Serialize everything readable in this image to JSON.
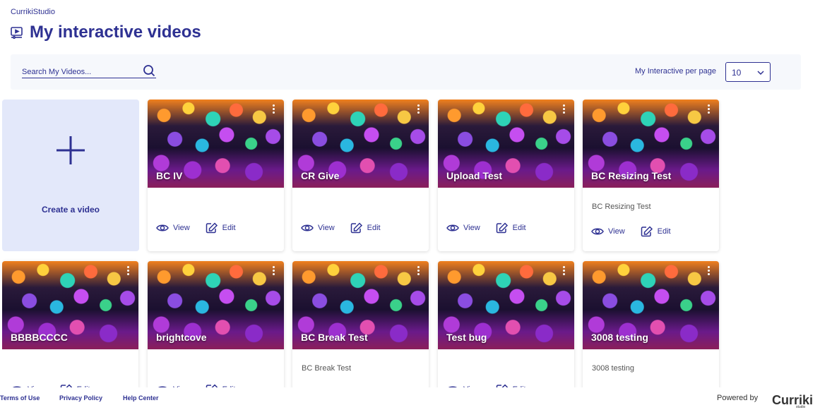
{
  "breadcrumb": "CurrikiStudio",
  "page_title": "My interactive videos",
  "search": {
    "placeholder": "Search My Videos..."
  },
  "per_page": {
    "label": "My Interactive per page",
    "value": "10"
  },
  "create_card": {
    "label": "Create a video"
  },
  "actions": {
    "view": "View",
    "edit": "Edit"
  },
  "videos": [
    {
      "title": "BC IV",
      "description": ""
    },
    {
      "title": "CR Give",
      "description": ""
    },
    {
      "title": "Upload Test",
      "description": ""
    },
    {
      "title": "BC Resizing Test",
      "description": "BC Resizing Test"
    },
    {
      "title": "BBBBCCCC",
      "description": ""
    },
    {
      "title": "brightcove",
      "description": ""
    },
    {
      "title": "BC Break Test",
      "description": "BC Break Test"
    },
    {
      "title": "Test bug",
      "description": ""
    },
    {
      "title": "3008 testing",
      "description": "3008 testing"
    }
  ],
  "footer": {
    "terms": "Terms of Use",
    "privacy": "Privacy Policy",
    "help": "Help Center",
    "powered_by": "Powered by",
    "logo_text": "Curriki",
    "logo_sub": "studio"
  },
  "colors": {
    "primary": "#2e3192",
    "toolbar_bg": "#f6f8fc",
    "create_card_bg": "#e3e8fa"
  },
  "icons": [
    "video-library-icon",
    "search-icon",
    "chevron-down-icon",
    "plus-icon",
    "eye-icon",
    "edit-icon",
    "kebab-menu-icon"
  ]
}
